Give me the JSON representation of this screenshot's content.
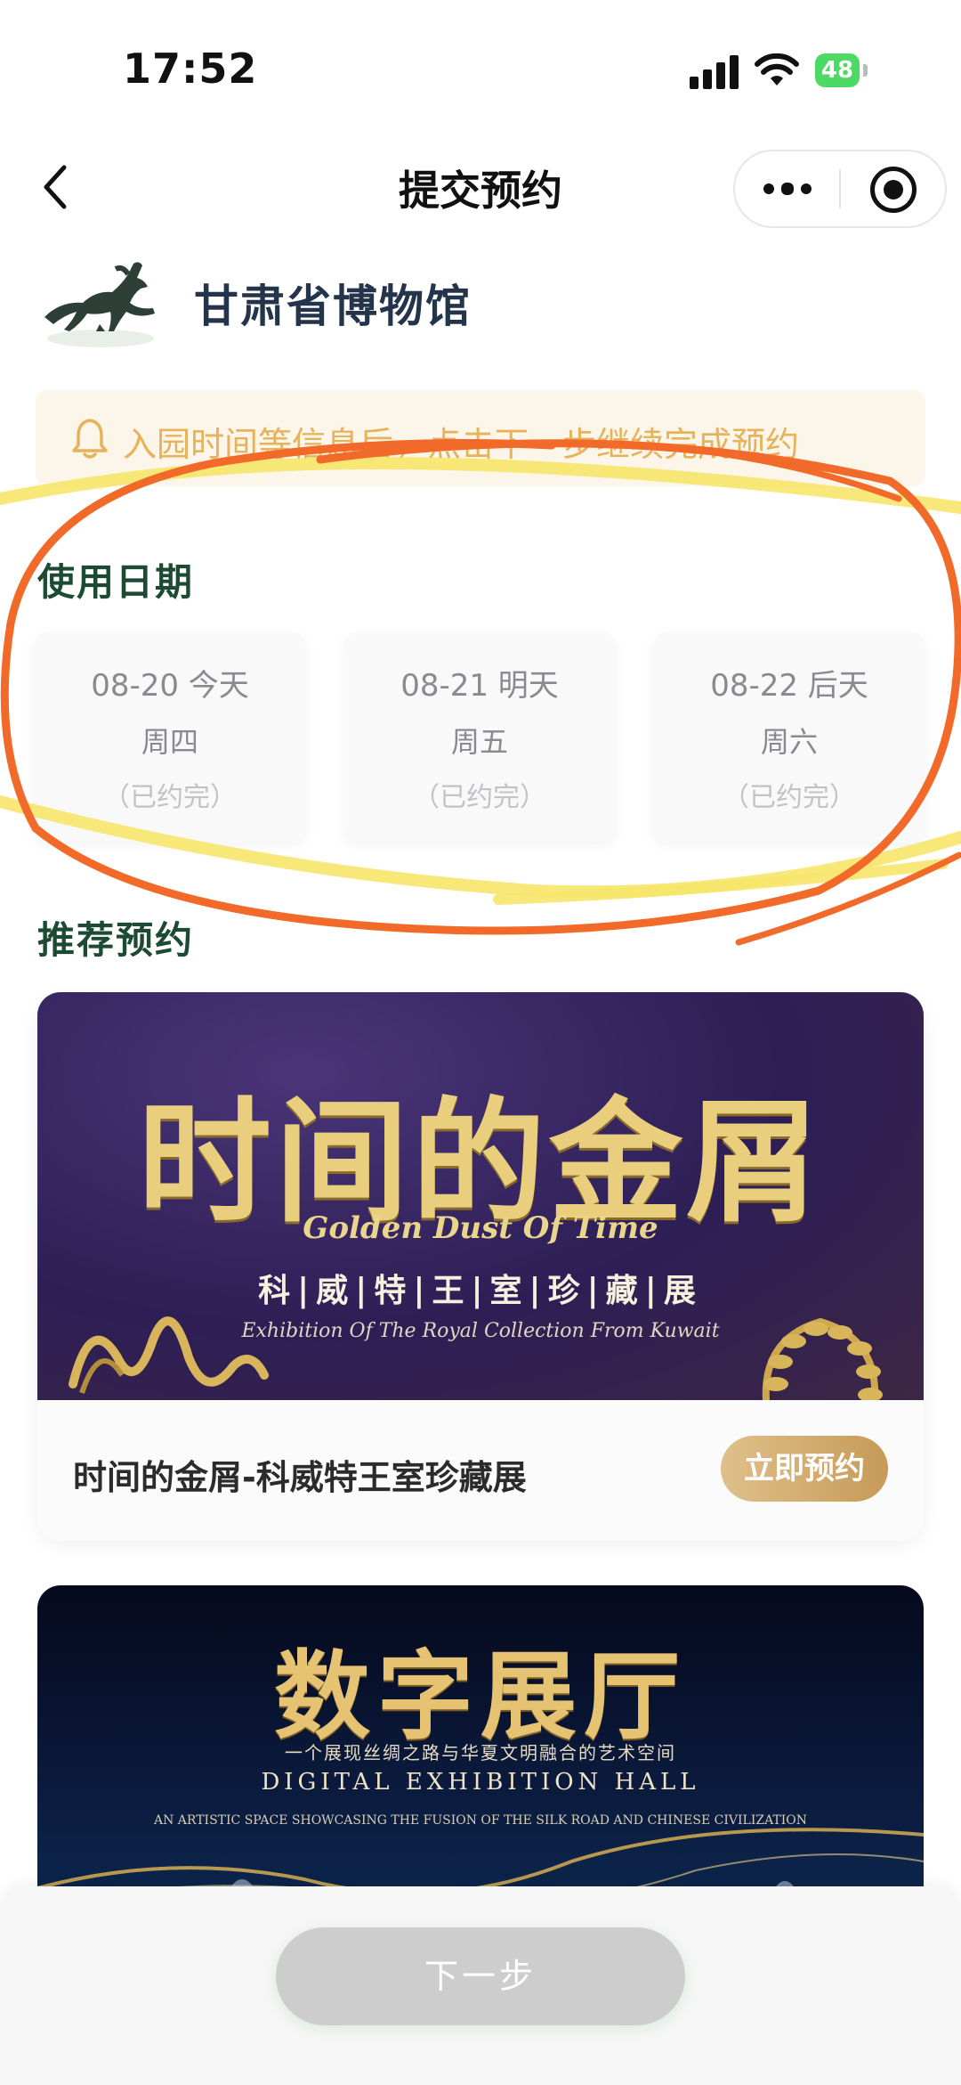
{
  "status_bar": {
    "time": "17:52",
    "battery": "48"
  },
  "nav": {
    "title": "提交预约"
  },
  "museum": {
    "name": "甘肃省博物馆"
  },
  "notice": {
    "text": "入园时间等信息后，点击下一步继续完成预约"
  },
  "date_section": {
    "title": "使用日期",
    "dates": [
      {
        "date": "08-20 今天",
        "weekday": "周四",
        "status": "（已约完）"
      },
      {
        "date": "08-21 明天",
        "weekday": "周五",
        "status": "（已约完）"
      },
      {
        "date": "08-22 后天",
        "weekday": "周六",
        "status": "（已约完）"
      }
    ]
  },
  "recommend": {
    "title": "推荐预约",
    "items": [
      {
        "banner_title": "时间的金屑",
        "banner_en": "Golden Dust Of Time",
        "banner_subtitle": "科|威|特|王|室|珍|藏|展",
        "banner_en2": "Exhibition Of The Royal Collection From Kuwait",
        "name": "时间的金屑-科威特王室珍藏展",
        "button": "立即预约"
      },
      {
        "banner_title": "数字展厅",
        "banner_subtitle": "一个展现丝绸之路与华夏文明融合的艺术空间",
        "banner_en": "DIGITAL EXHIBITION HALL",
        "banner_en2": "AN ARTISTIC SPACE SHOWCASING THE FUSION OF THE SILK ROAD AND CHINESE CIVILIZATION"
      }
    ]
  },
  "bottom": {
    "next_label": "下一步"
  },
  "colors": {
    "accent_gold": "#c79a57",
    "section_green": "#1c4a33",
    "notice_text": "#e6b25a",
    "disabled_button": "#cdcdcd",
    "scribble_orange": "#f26a2a",
    "scribble_yellow": "#f6e66a"
  },
  "icons": [
    "back-icon",
    "more-icon",
    "close-miniprogram-icon",
    "bell-icon",
    "signal-icon",
    "wifi-icon",
    "battery-icon",
    "museum-horse-logo"
  ]
}
